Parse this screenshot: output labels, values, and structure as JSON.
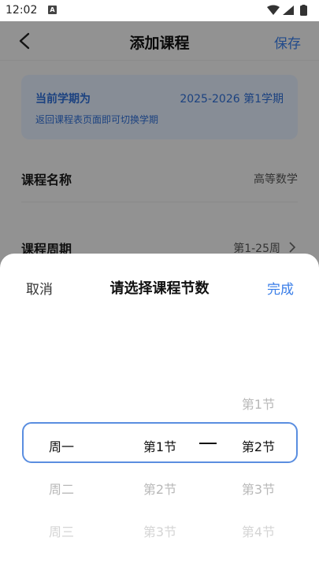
{
  "status_bar": {
    "time": "12:02",
    "badge": "A"
  },
  "nav": {
    "title": "添加课程",
    "save_label": "保存"
  },
  "term_card": {
    "label": "当前学期为",
    "value": "2025-2026  第1学期",
    "hint": "返回课程表页面即可切换学期"
  },
  "form": {
    "course_name_label": "课程名称",
    "course_name_value": "高等数学",
    "course_weeks_label": "课程周期",
    "course_weeks_value": "第1-25周"
  },
  "sheet": {
    "cancel_label": "取消",
    "title": "请选择课程节数",
    "done_label": "完成",
    "day_column": {
      "selected": "周一",
      "below": [
        "周二",
        "周三"
      ]
    },
    "start_column": {
      "selected": "第1节",
      "below": [
        "第2节",
        "第3节"
      ]
    },
    "end_column": {
      "above": "第1节",
      "selected": "第2节",
      "below": [
        "第3节",
        "第4节"
      ]
    }
  },
  "colors": {
    "accent": "#3a7ee8",
    "card_bg": "#e2ebfa",
    "highlight_border": "#5a8ee0"
  }
}
